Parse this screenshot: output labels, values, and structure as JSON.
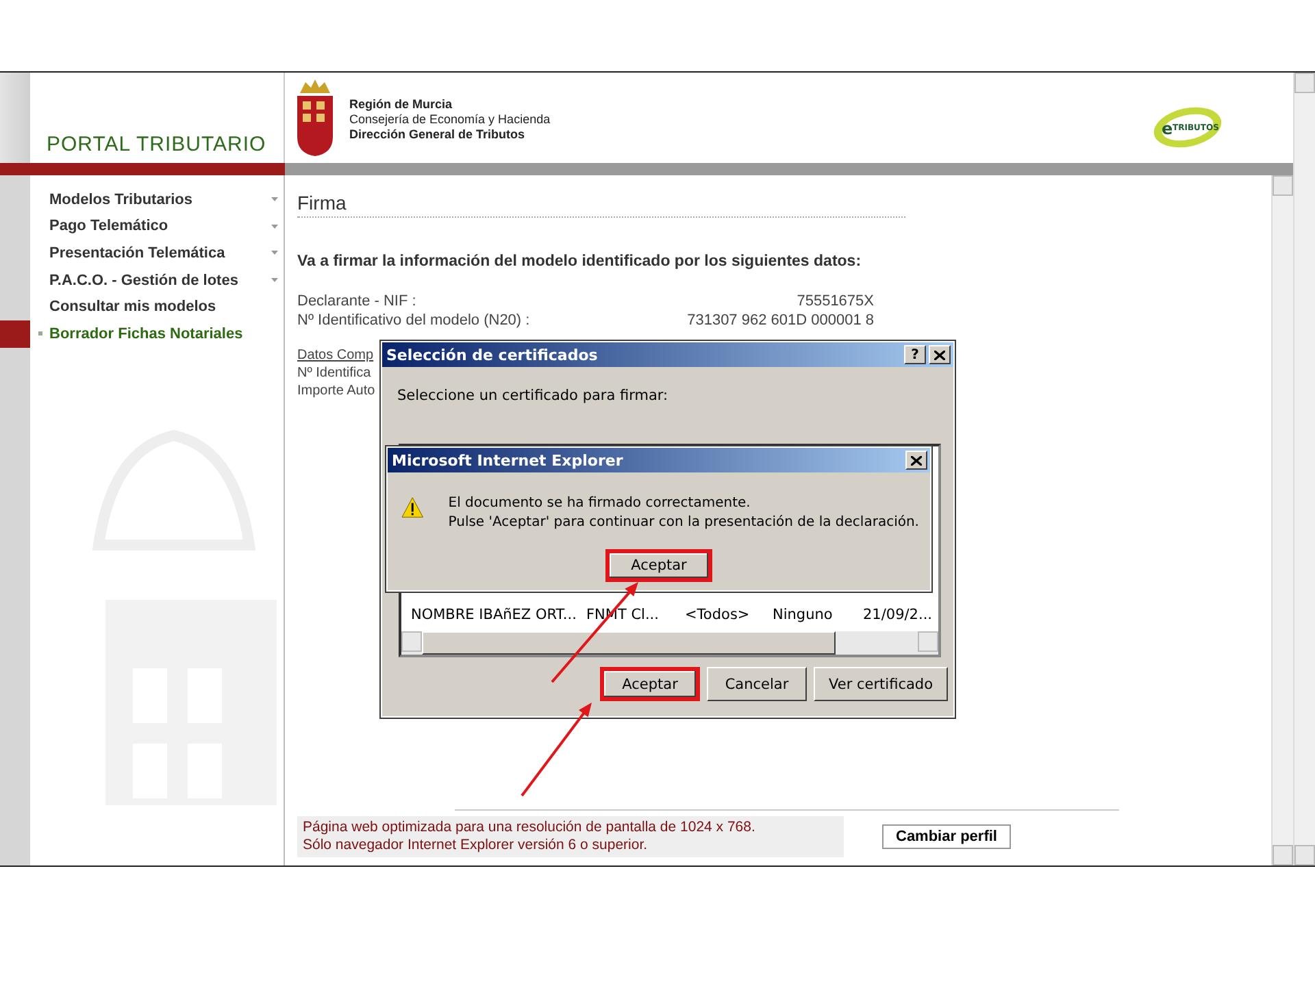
{
  "header": {
    "portal_title": "PORTAL TRIBUTARIO",
    "org_lines": [
      {
        "text": "Región de Murcia",
        "bold": true
      },
      {
        "text": "Consejería de Economía y Hacienda",
        "bold": false
      },
      {
        "text": "Dirección General de Tributos",
        "bold": true
      }
    ],
    "logo_letter": "e",
    "logo_text": "TRIBUTOS"
  },
  "sidebar": {
    "items": [
      {
        "label": "Modelos Tributarios",
        "has_submenu": true,
        "selected": false
      },
      {
        "label": "Pago Telemático",
        "has_submenu": true,
        "selected": false
      },
      {
        "label": "Presentación Telemática",
        "has_submenu": true,
        "selected": false
      },
      {
        "label": "P.A.C.O. - Gestión de lotes",
        "has_submenu": true,
        "selected": false
      },
      {
        "label": "Consultar mis modelos",
        "has_submenu": false,
        "selected": false
      },
      {
        "label": "Borrador Fichas Notariales",
        "has_submenu": false,
        "selected": true
      }
    ]
  },
  "main": {
    "title": "Firma",
    "intro": "Va a firmar la información del modelo identificado por los siguientes datos:",
    "fields": [
      {
        "label": "Declarante - NIF :",
        "value": "75551675X"
      },
      {
        "label": "Nº Identificativo del modelo (N20) :",
        "value": "731307 962 601D 000001 8"
      }
    ],
    "section_link": "Datos Comp",
    "partial_lines": [
      "Nº Identifica",
      "Importe Auto"
    ]
  },
  "footer": {
    "notice_lines": [
      "Página web optimizada para una resolución de pantalla de 1024 x 768.",
      "Sólo navegador Internet Explorer versión 6 o superior."
    ],
    "button": "Cambiar perfil"
  },
  "certificate_dialog": {
    "title": "Selección de certificados",
    "help": "?",
    "prompt": "Seleccione un certificado para firmar:",
    "rows": [
      {
        "cells": [
          "NOMBRE IBAñEZ ORT...",
          "FNMT Cl...",
          "<Todos>",
          "Ninguno",
          "21/09/2..."
        ]
      }
    ],
    "buttons": [
      {
        "label": "Aceptar",
        "highlighted": true
      },
      {
        "label": "Cancelar",
        "highlighted": false
      },
      {
        "label": "Ver certificado",
        "highlighted": false
      }
    ]
  },
  "alert_dialog": {
    "title": "Microsoft Internet Explorer",
    "message_lines": [
      "El documento se ha firmado correctamente.",
      "Pulse 'Aceptar' para continuar con la presentación de la declaración."
    ],
    "button": {
      "label": "Aceptar",
      "highlighted": true
    }
  }
}
